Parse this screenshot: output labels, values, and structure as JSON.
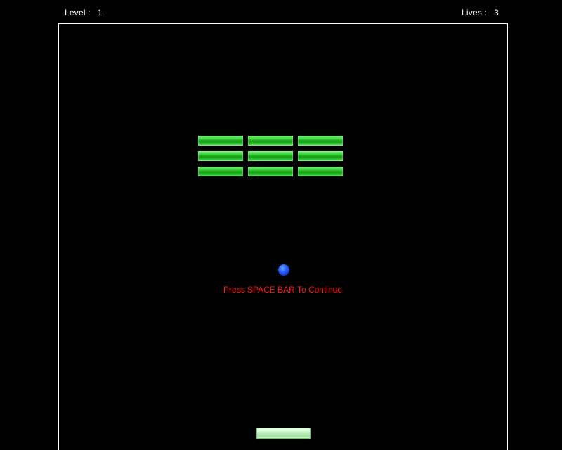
{
  "hud": {
    "level_label": "Level :",
    "level_value": "1",
    "lives_label": "Lives :",
    "lives_value": "3"
  },
  "bricks": {
    "rows": 3,
    "columns": 3,
    "color": "#2cc02c"
  },
  "ball": {
    "color": "#2660ff"
  },
  "message": {
    "text": "Press SPACE BAR To Continue",
    "color": "#ff1a1a"
  },
  "paddle": {
    "color": "#c9f5c9"
  },
  "colors": {
    "background": "#000000",
    "border": "#ffffff",
    "hud_text": "#ffffff"
  }
}
